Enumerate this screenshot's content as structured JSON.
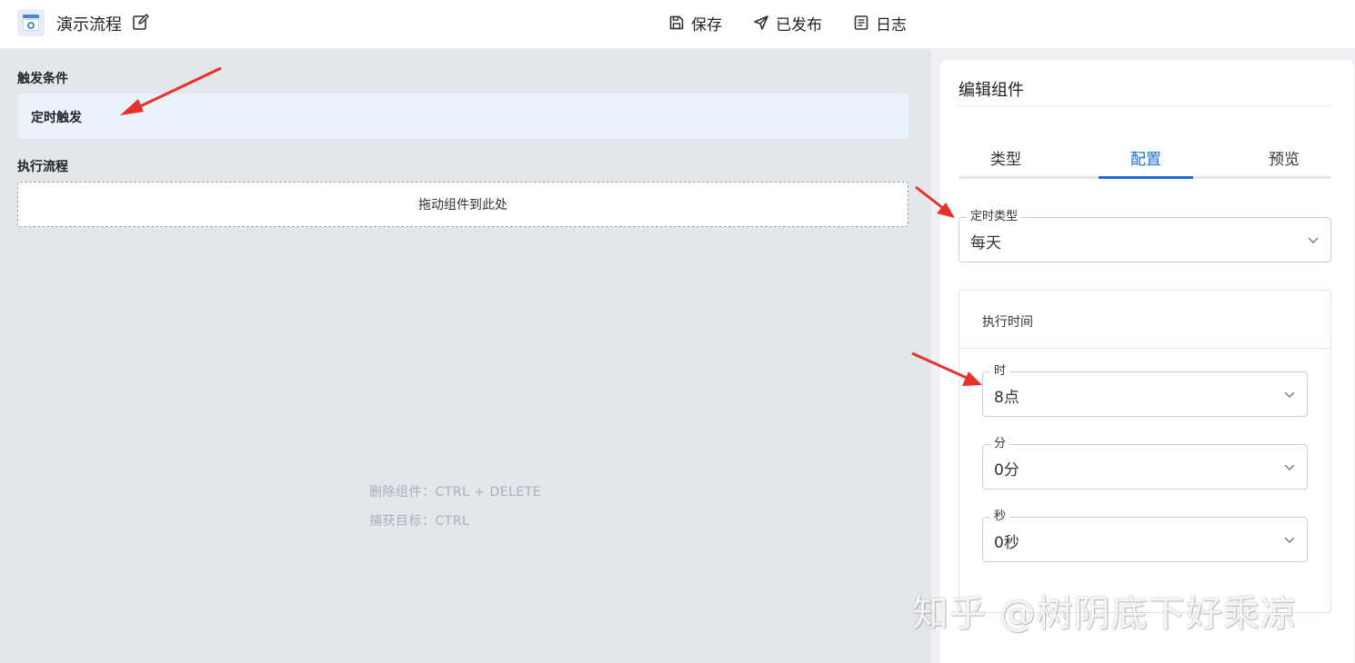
{
  "header": {
    "flow_title": "演示流程",
    "actions": [
      {
        "label": "保存",
        "icon": "save-icon"
      },
      {
        "label": "已发布",
        "icon": "send-icon"
      },
      {
        "label": "日志",
        "icon": "log-icon"
      }
    ]
  },
  "canvas": {
    "trigger_section_label": "触发条件",
    "trigger_item": "定时触发",
    "flow_section_label": "执行流程",
    "drop_zone_text": "拖动组件到此处",
    "hints": [
      "删除组件：CTRL + DELETE",
      "捕获目标：CTRL"
    ]
  },
  "panel": {
    "title": "编辑组件",
    "tabs": [
      "类型",
      "配置",
      "预览"
    ],
    "active_tab": "配置",
    "schedule_type": {
      "label": "定时类型",
      "value": "每天"
    },
    "exec_time": {
      "title": "执行时间",
      "hour": {
        "label": "时",
        "value": "8点"
      },
      "minute": {
        "label": "分",
        "value": "0分"
      },
      "second": {
        "label": "秒",
        "value": "0秒"
      }
    }
  },
  "watermark": "知乎 @树阴底下好乘凉",
  "colors": {
    "accent": "#1e6dd1",
    "canvas_bg": "#e3e6eb",
    "trigger_bg": "#eaf2fc",
    "arrow": "#e8312a"
  }
}
